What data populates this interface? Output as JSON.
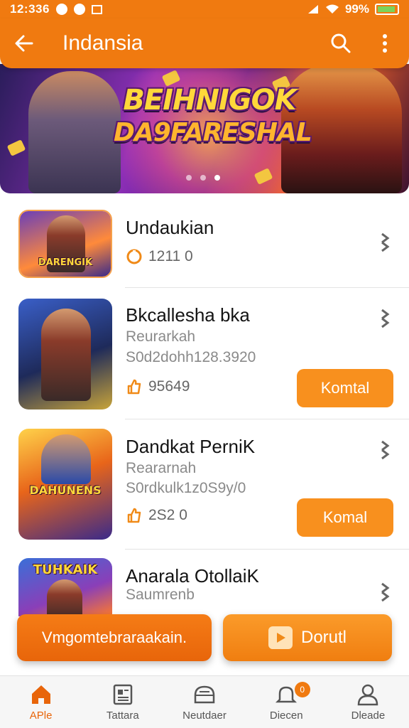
{
  "status_bar": {
    "time": "12:336",
    "battery": "99%"
  },
  "app_bar": {
    "title": "Indansia",
    "back_icon": "arrow-left-icon",
    "search_icon": "search-icon",
    "menu_icon": "more-vertical-icon"
  },
  "banner": {
    "line1": "BEIHNIGOK",
    "line2": "DA9FARESHAL",
    "slide_count": 3,
    "active_slide": 3
  },
  "items": [
    {
      "title": "Undaukian",
      "meta": "1211 0",
      "thumb_label": "DARENGIK"
    },
    {
      "title": "Bkcallesha bka",
      "subtitle": "Reurarkah",
      "detail": "S0d2dohh128.3920",
      "meta": "95649",
      "button": "Komtal"
    },
    {
      "title": "Dandkat PerniK",
      "subtitle": "Reararnah",
      "detail": "S0rdkulk1z0S9y/0",
      "meta": "2S2 0",
      "button": "Komal",
      "thumb_label": "DAHUNENS"
    },
    {
      "title": "Anarala OtollaiK",
      "subtitle": "Saumrenb",
      "thumb_label": "TUHKAIK"
    }
  ],
  "cta": {
    "left": "Vmgomtebraraakain.",
    "right": "Dorutl"
  },
  "bottom_nav": [
    {
      "label": "APle",
      "icon": "home-icon",
      "active": true
    },
    {
      "label": "Tattara",
      "icon": "apps-icon"
    },
    {
      "label": "Neutdaer",
      "icon": "inbox-icon"
    },
    {
      "label": "Diecen",
      "icon": "bell-icon",
      "badge": "0"
    },
    {
      "label": "Dleade",
      "icon": "profile-icon"
    }
  ],
  "colors": {
    "primary": "#f07a10",
    "button": "#f8901e"
  }
}
